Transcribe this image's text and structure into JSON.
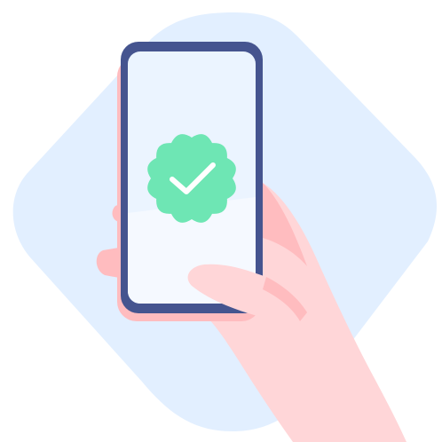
{
  "illustration": {
    "subject": "hand-holding-phone-verified",
    "colors": {
      "background": "#ffffff",
      "blob": "#e2efff",
      "phone_frame": "#45548f",
      "phone_screen": "#ebf4ff",
      "phone_screen_lower": "#f5f9ff",
      "badge": "#6ee6b4",
      "checkmark": "#ffffff",
      "skin_light": "#ffd6d8",
      "skin_shadow": "#ffbcbf"
    },
    "icons": [
      "verified-badge-icon",
      "checkmark-icon"
    ]
  }
}
